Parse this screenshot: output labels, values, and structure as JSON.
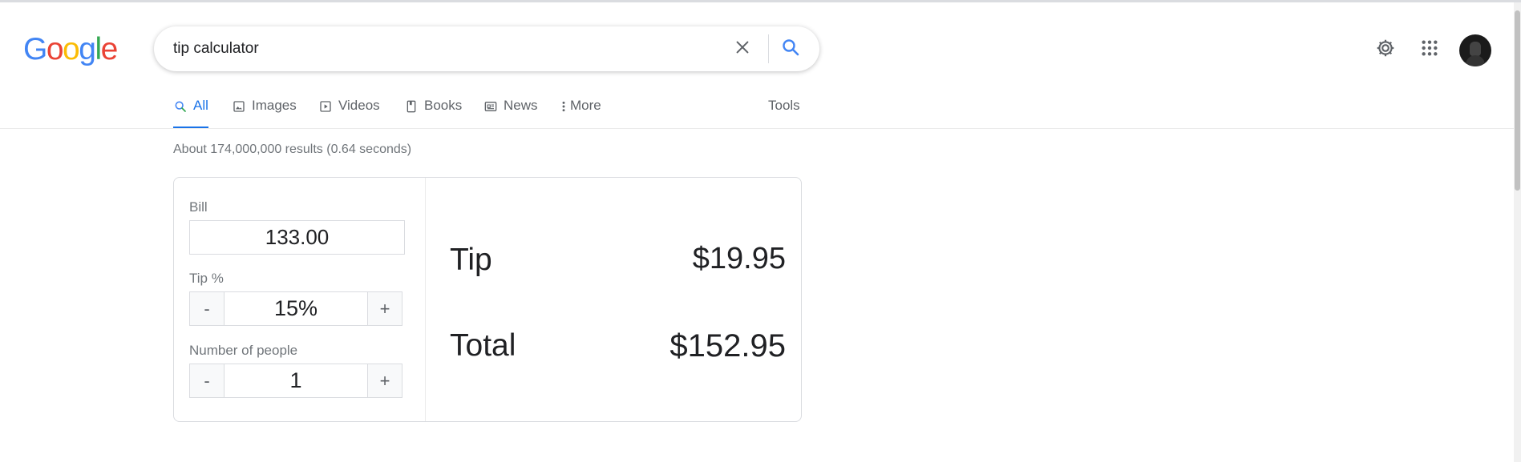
{
  "logo": {
    "letters": [
      "G",
      "o",
      "o",
      "g",
      "l",
      "e"
    ]
  },
  "search": {
    "query": "tip calculator",
    "placeholder": ""
  },
  "icons": {
    "clear": "close-icon",
    "search": "search-icon",
    "settings": "gear-icon",
    "apps": "apps-grid-icon",
    "avatar": "avatar"
  },
  "tabs": [
    {
      "label": "All",
      "icon": "search-icon",
      "active": true
    },
    {
      "label": "Images",
      "icon": "image-icon"
    },
    {
      "label": "Videos",
      "icon": "play-icon"
    },
    {
      "label": "Books",
      "icon": "book-icon"
    },
    {
      "label": "News",
      "icon": "news-icon"
    },
    {
      "label": "More",
      "icon": "more-vert-icon"
    },
    {
      "label": "Tools"
    }
  ],
  "result_stats": "About 174,000,000 results (0.64 seconds)",
  "calculator": {
    "bill_label": "Bill",
    "bill_value": "133.00",
    "tip_pct_label": "Tip %",
    "tip_pct_value": "15%",
    "people_label": "Number of people",
    "people_value": "1",
    "minus": "-",
    "plus": "+",
    "tip_label": "Tip",
    "tip_value": "$19.95",
    "total_label": "Total",
    "total_value": "$152.95"
  },
  "colors": {
    "accent": "#1a73e8",
    "text": "#202124",
    "muted": "#70757a",
    "border": "#dadce0"
  }
}
